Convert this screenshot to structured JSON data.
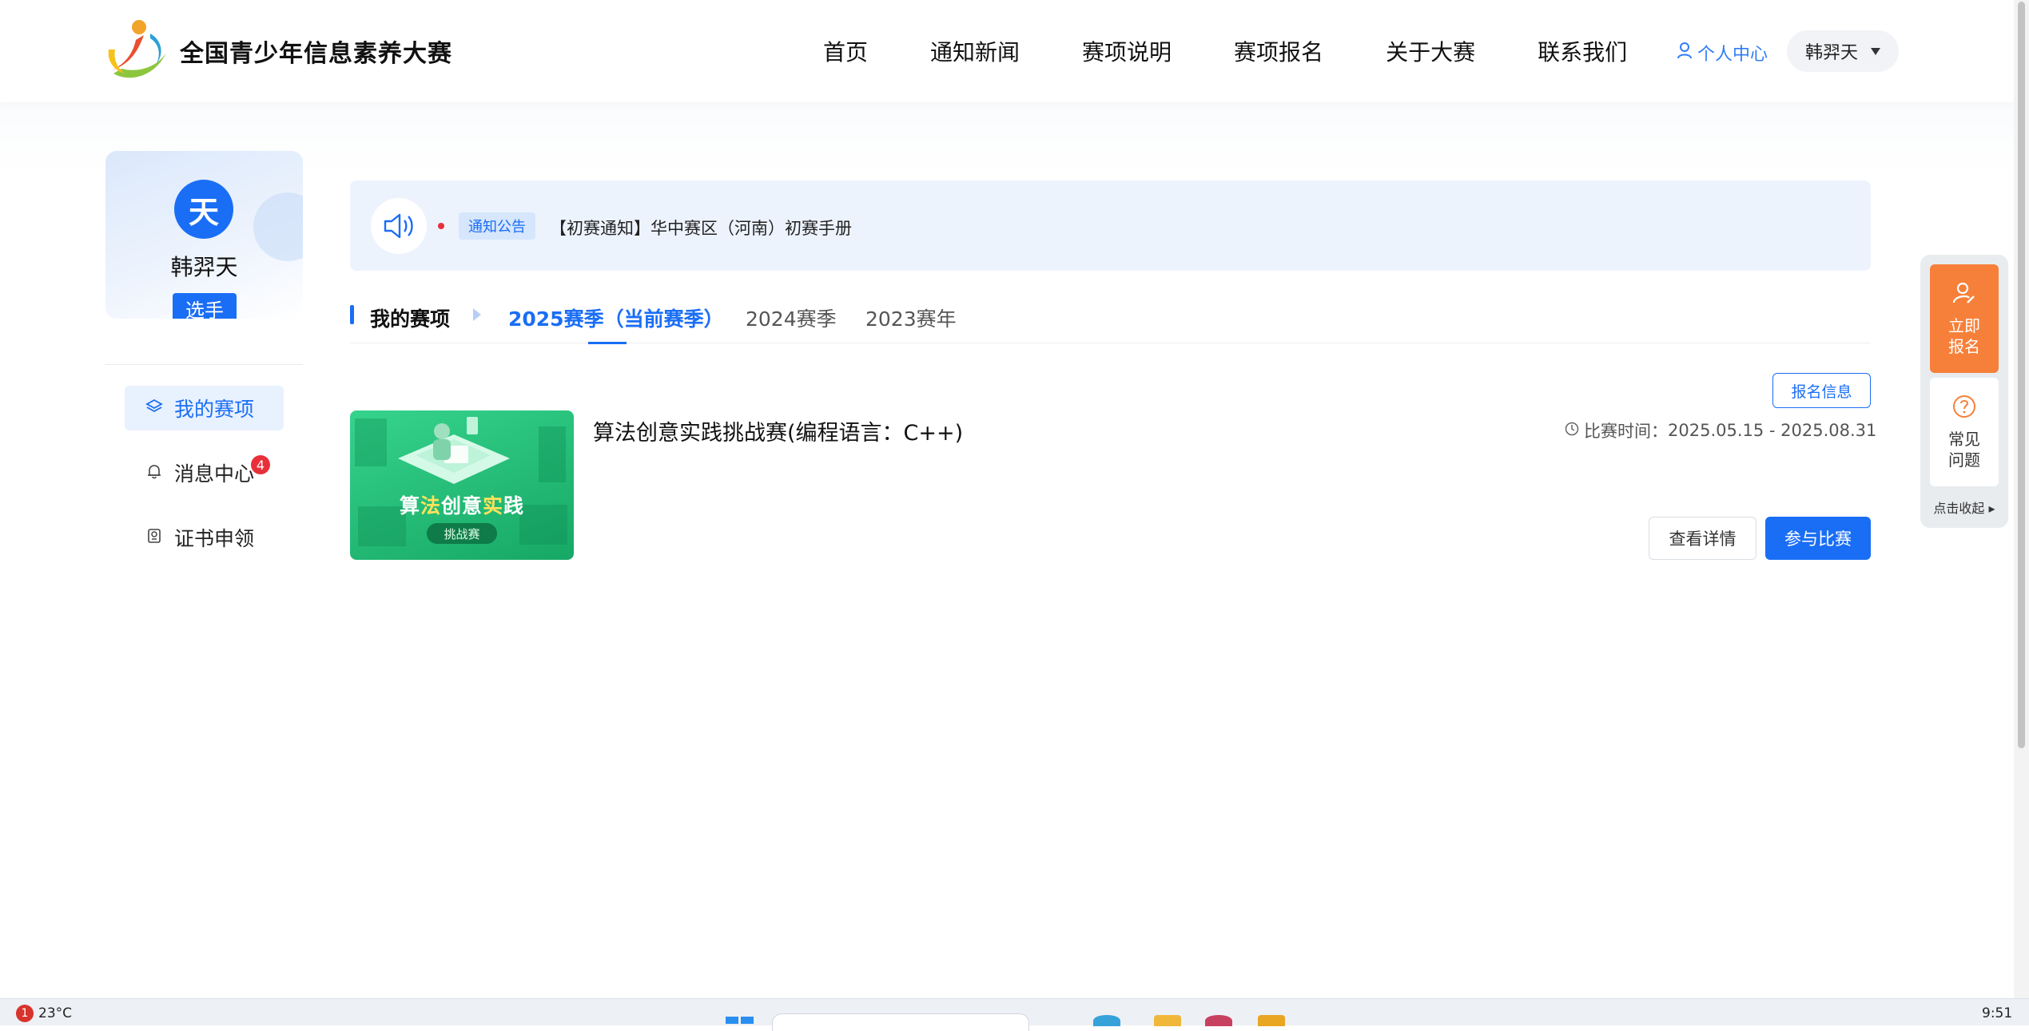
{
  "header": {
    "site_title": "全国青少年信息素养大赛",
    "nav": [
      "首页",
      "通知新闻",
      "赛项说明",
      "赛项报名",
      "关于大赛",
      "联系我们"
    ],
    "personal_center": "个人中心",
    "user_name": "韩羿天"
  },
  "sidebar": {
    "avatar_char": "天",
    "name": "韩羿天",
    "role": "选手",
    "menu": [
      {
        "label": "我的赛项",
        "icon": "layers-icon",
        "active": true
      },
      {
        "label": "消息中心",
        "icon": "bell-icon",
        "badge": "4"
      },
      {
        "label": "证书申领",
        "icon": "certificate-icon"
      }
    ]
  },
  "notice": {
    "tag": "通知公告",
    "text": "【初赛通知】华中赛区（河南）初赛手册"
  },
  "tabs": {
    "heading": "我的赛项",
    "items": [
      "2025赛季（当前赛季）",
      "2024赛季",
      "2023赛年"
    ],
    "active_index": 0
  },
  "competition": {
    "register_info_button": "报名信息",
    "thumb_title_part1": "算",
    "thumb_title_highlight1": "法",
    "thumb_title_part2": "创意",
    "thumb_title_highlight2": "实",
    "thumb_title_part3": "践",
    "thumb_pill": "挑战赛",
    "title": "算法创意实践挑战赛(编程语言：C++)",
    "time_label": "比赛时间：",
    "time_value": "2025.05.15 - 2025.08.31",
    "detail_button": "查看详情",
    "join_button": "参与比赛"
  },
  "float_panel": {
    "register_line1": "立即",
    "register_line2": "报名",
    "faq_line1": "常见",
    "faq_line2": "问题",
    "collapse": "点击收起"
  },
  "taskbar": {
    "weather_badge": "1",
    "temperature": "23°C",
    "clock": "9:51"
  },
  "colors": {
    "primary": "#1a6ef5",
    "orange": "#f6803a",
    "badge_red": "#e8303a",
    "thumb_green": "#16a865"
  }
}
